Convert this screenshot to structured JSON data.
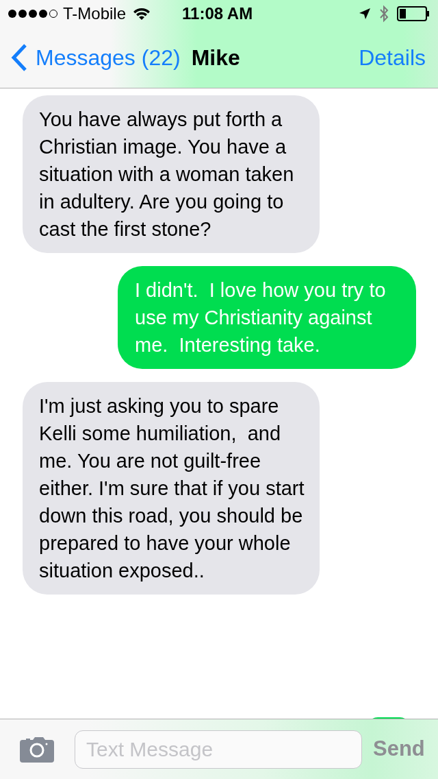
{
  "status_bar": {
    "carrier": "T-Mobile",
    "time": "11:08 AM"
  },
  "nav": {
    "back": "Messages (22)",
    "title": "Mike",
    "action": "Details"
  },
  "messages": [
    {
      "kind": "incoming",
      "text": "You have always put forth a Christian image. You have a situation with a woman taken in adultery. Are you going to cast the first stone?"
    },
    {
      "kind": "outgoing",
      "text": "I didn't.  I love how you try to use my Christianity against me.  Interesting take."
    },
    {
      "kind": "incoming",
      "text": "I'm just asking you to spare Kelli some humiliation,  and me. You are not guilt-free either. I'm sure that if you start down this road, you should be prepared to have your whole situation exposed.."
    }
  ],
  "composer": {
    "placeholder": "Text Message",
    "send": "Send",
    "send_disabled": true
  }
}
